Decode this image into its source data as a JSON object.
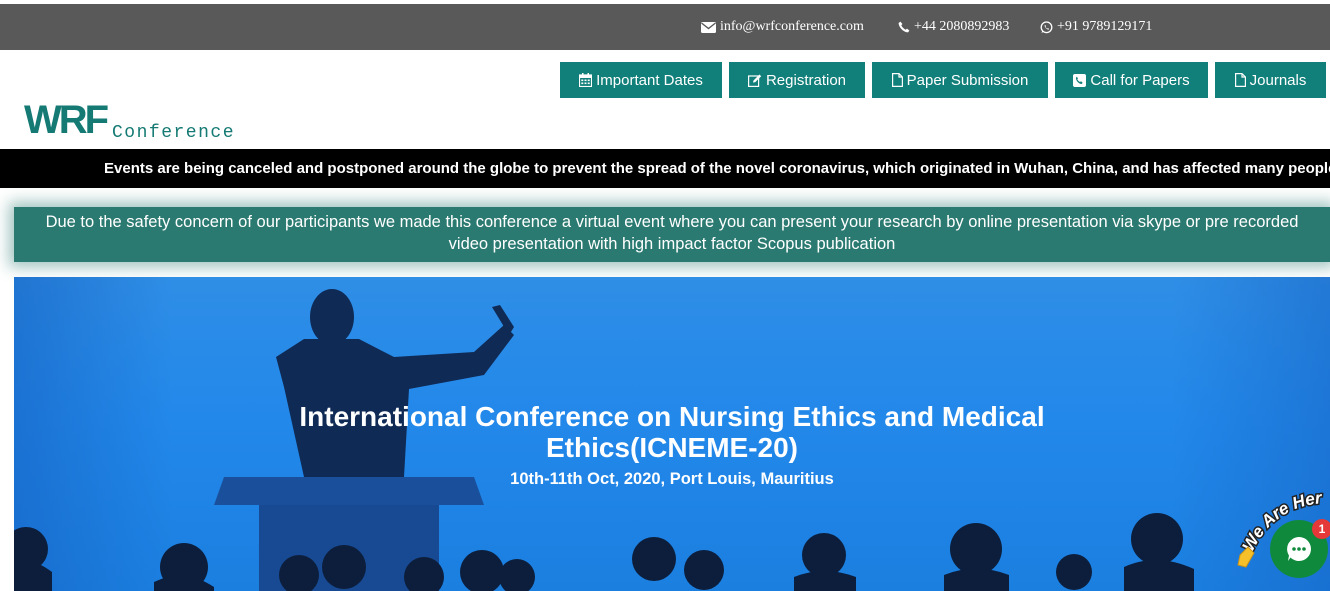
{
  "contact": {
    "email": "info@wrfconference.com",
    "phone": "+44 2080892983",
    "whatsapp": "+91 9789129171",
    "icons": [
      "envelope-icon",
      "phone-icon",
      "whatsapp-icon"
    ]
  },
  "logo": {
    "mark": "WRF",
    "sub": "Conference",
    "color": "#157a74"
  },
  "nav": {
    "important_dates": "Important Dates",
    "registration": "Registration",
    "paper_submission": "Paper Submission",
    "call_for_papers": "Call for Papers",
    "journals": "Journals",
    "button_color": "#117f7a",
    "icons": [
      "calendar-icon",
      "edit-icon",
      "file-icon",
      "phone-square-icon",
      "file-icon"
    ]
  },
  "ticker": {
    "text": "Events are being canceled and postponed around the globe to prevent the spread of the novel coronavirus, which originated in Wuhan, China, and has affected many people"
  },
  "notice": {
    "text": "Due to the safety concern of our participants we made this conference a virtual event where you can present your research by online presentation via skype or pre recorded video presentation with high impact factor Scopus publication",
    "color": "#2b7a71"
  },
  "hero": {
    "title": "International Conference on Nursing Ethics and Medical Ethics(ICNEME-20)",
    "subtitle": "10th-11th Oct, 2020, Port Louis, Mauritius",
    "background": "#2288ea"
  },
  "chat": {
    "wave_text": "We Are Here!",
    "badge_count": "1",
    "icon": "chat-bubble-icon"
  }
}
